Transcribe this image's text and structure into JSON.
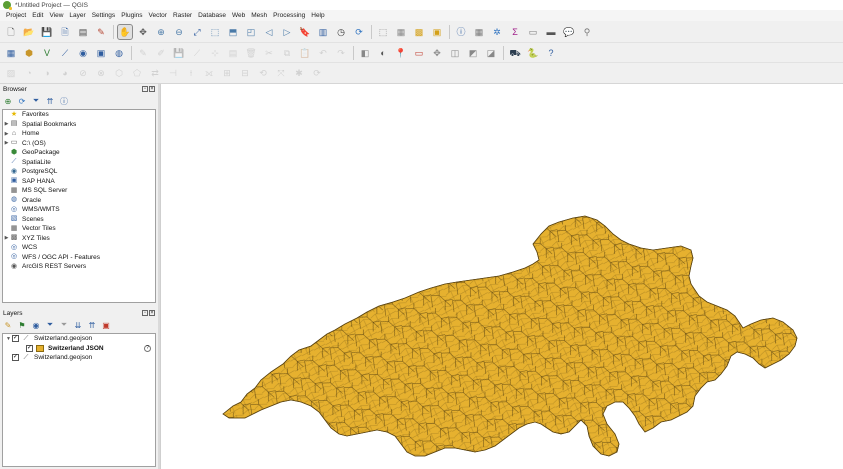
{
  "window": {
    "title": "*Untitled Project — QGIS"
  },
  "menu": [
    "Project",
    "Edit",
    "View",
    "Layer",
    "Settings",
    "Plugins",
    "Vector",
    "Raster",
    "Database",
    "Web",
    "Mesh",
    "Processing",
    "Help"
  ],
  "toolbars": {
    "row1": [
      {
        "name": "new-project-icon",
        "glyph": "🗋",
        "color": "#555",
        "active": false,
        "dim": false
      },
      {
        "name": "open-project-icon",
        "glyph": "📂",
        "color": "#c8962b",
        "active": false,
        "dim": false
      },
      {
        "name": "save-project-icon",
        "glyph": "💾",
        "color": "#2f5d9f",
        "active": false,
        "dim": false
      },
      {
        "name": "save-as-icon",
        "glyph": "🗎",
        "color": "#2f5d9f",
        "active": false,
        "dim": false
      },
      {
        "name": "print-layout-icon",
        "glyph": "▤",
        "color": "#444",
        "active": false,
        "dim": false
      },
      {
        "name": "style-manager-icon",
        "glyph": "✎",
        "color": "#b54632",
        "active": false,
        "dim": false
      },
      {
        "sep": true
      },
      {
        "name": "pan-map-icon",
        "glyph": "✋",
        "color": "#333",
        "active": true,
        "dim": false
      },
      {
        "name": "pan-to-selection-icon",
        "glyph": "✥",
        "color": "#555",
        "active": false,
        "dim": false
      },
      {
        "name": "zoom-in-icon",
        "glyph": "⊕",
        "color": "#4a7aa8",
        "active": false,
        "dim": false
      },
      {
        "name": "zoom-out-icon",
        "glyph": "⊖",
        "color": "#4a7aa8",
        "active": false,
        "dim": false
      },
      {
        "name": "zoom-full-icon",
        "glyph": "⤢",
        "color": "#2f5d9f",
        "active": false,
        "dim": false
      },
      {
        "name": "zoom-selection-icon",
        "glyph": "⬚",
        "color": "#4a7aa8",
        "active": false,
        "dim": false
      },
      {
        "name": "zoom-layer-icon",
        "glyph": "⬒",
        "color": "#4a7aa8",
        "active": false,
        "dim": false
      },
      {
        "name": "zoom-native-icon",
        "glyph": "◰",
        "color": "#4a7aa8",
        "active": false,
        "dim": false
      },
      {
        "name": "zoom-last-icon",
        "glyph": "◁",
        "color": "#4a7aa8",
        "active": false,
        "dim": false
      },
      {
        "name": "zoom-next-icon",
        "glyph": "▷",
        "color": "#4a7aa8",
        "active": false,
        "dim": false
      },
      {
        "name": "new-bookmark-icon",
        "glyph": "🔖",
        "color": "#2f5d9f",
        "active": false,
        "dim": false
      },
      {
        "name": "show-bookmarks-icon",
        "glyph": "▥",
        "color": "#2f5d9f",
        "active": false,
        "dim": false
      },
      {
        "name": "temporal-controller-icon",
        "glyph": "◷",
        "color": "#333",
        "active": false,
        "dim": false
      },
      {
        "name": "refresh-icon",
        "glyph": "⟳",
        "color": "#2f73c0",
        "active": false,
        "dim": false
      },
      {
        "sep": true
      },
      {
        "name": "select-features-icon",
        "glyph": "⬚",
        "color": "#888",
        "active": false,
        "dim": false
      },
      {
        "name": "select-by-value-icon",
        "glyph": "▦",
        "color": "#888",
        "active": false,
        "dim": false
      },
      {
        "name": "deselect-icon",
        "glyph": "▩",
        "color": "#d4a017",
        "active": false,
        "dim": false
      },
      {
        "name": "select-by-location-icon",
        "glyph": "▣",
        "color": "#d4a017",
        "active": false,
        "dim": false
      },
      {
        "sep": true
      },
      {
        "name": "identify-icon",
        "glyph": "ⓘ",
        "color": "#2f5d9f",
        "active": false,
        "dim": false
      },
      {
        "name": "attribute-table-icon",
        "glyph": "▦",
        "color": "#777",
        "active": false,
        "dim": false
      },
      {
        "name": "field-calculator-icon",
        "glyph": "✲",
        "color": "#2f73c0",
        "active": false,
        "dim": false
      },
      {
        "name": "statistics-icon",
        "glyph": "Σ",
        "color": "#a0208a",
        "active": false,
        "dim": false
      },
      {
        "name": "open-table-icon",
        "glyph": "▭",
        "color": "#777",
        "active": false,
        "dim": false
      },
      {
        "name": "measure-icon",
        "glyph": "▬",
        "color": "#555",
        "active": false,
        "dim": false
      },
      {
        "name": "map-tips-icon",
        "glyph": "💬",
        "color": "#e8c21a",
        "active": false,
        "dim": false
      },
      {
        "name": "search-icon",
        "glyph": "⚲",
        "color": "#777",
        "active": false,
        "dim": false
      }
    ],
    "row2": [
      {
        "name": "data-source-manager-icon",
        "glyph": "▦",
        "color": "#2f5d9f",
        "active": false,
        "dim": false
      },
      {
        "name": "new-geopackage-layer-icon",
        "glyph": "⬢",
        "color": "#c8962b",
        "active": false,
        "dim": false
      },
      {
        "name": "add-vector-layer-icon",
        "glyph": "V",
        "color": "#2e7d32",
        "active": false,
        "dim": false
      },
      {
        "name": "add-raster-layer-icon",
        "glyph": "⟋",
        "color": "#2f5d9f",
        "active": false,
        "dim": false
      },
      {
        "name": "add-postgis-layer-icon",
        "glyph": "◉",
        "color": "#2f5d9f",
        "active": false,
        "dim": false
      },
      {
        "name": "add-mssql-layer-icon",
        "glyph": "▣",
        "color": "#2f5d9f",
        "active": false,
        "dim": false
      },
      {
        "name": "add-wms-layer-icon",
        "glyph": "◍",
        "color": "#2f5d9f",
        "active": false,
        "dim": false
      },
      {
        "sep": true
      },
      {
        "name": "toggle-editing-icon",
        "glyph": "✎",
        "color": "#999",
        "active": false,
        "dim": true
      },
      {
        "name": "edit-pencil-icon",
        "glyph": "✐",
        "color": "#999",
        "active": false,
        "dim": true
      },
      {
        "name": "save-edits-icon",
        "glyph": "💾",
        "color": "#999",
        "active": false,
        "dim": true
      },
      {
        "name": "digitize-icon",
        "glyph": "⟋",
        "color": "#999",
        "active": false,
        "dim": true
      },
      {
        "name": "vertex-tool-icon",
        "glyph": "⊹",
        "color": "#999",
        "active": false,
        "dim": true
      },
      {
        "name": "modify-attributes-icon",
        "glyph": "▤",
        "color": "#999",
        "active": false,
        "dim": true
      },
      {
        "name": "delete-selected-icon",
        "glyph": "🗑",
        "color": "#999",
        "active": false,
        "dim": true
      },
      {
        "name": "cut-features-icon",
        "glyph": "✂",
        "color": "#999",
        "active": false,
        "dim": true
      },
      {
        "name": "copy-features-icon",
        "glyph": "⧉",
        "color": "#999",
        "active": false,
        "dim": true
      },
      {
        "name": "paste-features-icon",
        "glyph": "📋",
        "color": "#999",
        "active": false,
        "dim": true
      },
      {
        "name": "undo-icon",
        "glyph": "↶",
        "color": "#999",
        "active": false,
        "dim": true
      },
      {
        "name": "redo-icon",
        "glyph": "↷",
        "color": "#999",
        "active": false,
        "dim": true
      },
      {
        "sep": true
      },
      {
        "name": "label-tool-icon",
        "glyph": "◧",
        "color": "#888",
        "active": false,
        "dim": false
      },
      {
        "name": "layer-labeling-icon",
        "glyph": "◐",
        "color": "#555",
        "active": false,
        "dim": false
      },
      {
        "name": "pin-labels-icon",
        "glyph": "📍",
        "color": "#c0392b",
        "active": false,
        "dim": false
      },
      {
        "name": "highlight-labels-icon",
        "glyph": "▭",
        "color": "#c0392b",
        "active": false,
        "dim": false
      },
      {
        "name": "move-label-icon",
        "glyph": "✥",
        "color": "#888",
        "active": false,
        "dim": false
      },
      {
        "name": "rotate-label-icon",
        "glyph": "◫",
        "color": "#888",
        "active": false,
        "dim": false
      },
      {
        "name": "change-label-icon",
        "glyph": "◩",
        "color": "#888",
        "active": false,
        "dim": false
      },
      {
        "name": "show-hide-labels-icon",
        "glyph": "◪",
        "color": "#888",
        "active": false,
        "dim": false
      },
      {
        "sep": true
      },
      {
        "name": "gps-tracker-icon",
        "glyph": "⛟",
        "color": "#2c3e50",
        "active": false,
        "dim": false
      },
      {
        "name": "python-console-icon",
        "glyph": "🐍",
        "color": "#2f73c0",
        "active": false,
        "dim": false
      },
      {
        "name": "help-contents-icon",
        "glyph": "?",
        "color": "#2f5d9f",
        "active": false,
        "dim": false
      }
    ],
    "row3": [
      {
        "name": "digitize-shape-icon",
        "glyph": "▨",
        "color": "#999",
        "active": false,
        "dim": true
      },
      {
        "name": "add-ring-icon",
        "glyph": "◔",
        "color": "#999",
        "active": false,
        "dim": true
      },
      {
        "name": "add-part-icon",
        "glyph": "◑",
        "color": "#999",
        "active": false,
        "dim": true
      },
      {
        "name": "fill-ring-icon",
        "glyph": "◕",
        "color": "#999",
        "active": false,
        "dim": true
      },
      {
        "name": "delete-ring-icon",
        "glyph": "⊘",
        "color": "#999",
        "active": false,
        "dim": true
      },
      {
        "name": "delete-part-icon",
        "glyph": "⊗",
        "color": "#999",
        "active": false,
        "dim": true
      },
      {
        "name": "reshape-icon",
        "glyph": "⬡",
        "color": "#999",
        "active": false,
        "dim": true
      },
      {
        "name": "offset-curve-icon",
        "glyph": "⬠",
        "color": "#999",
        "active": false,
        "dim": true
      },
      {
        "name": "reverse-line-icon",
        "glyph": "⇄",
        "color": "#999",
        "active": false,
        "dim": true
      },
      {
        "name": "trim-extend-icon",
        "glyph": "⊣",
        "color": "#999",
        "active": false,
        "dim": true
      },
      {
        "name": "split-features-icon",
        "glyph": "⟊",
        "color": "#999",
        "active": false,
        "dim": true
      },
      {
        "name": "split-parts-icon",
        "glyph": "⟗",
        "color": "#999",
        "active": false,
        "dim": true
      },
      {
        "name": "merge-features-icon",
        "glyph": "⊞",
        "color": "#999",
        "active": false,
        "dim": true
      },
      {
        "name": "merge-attributes-icon",
        "glyph": "⊟",
        "color": "#999",
        "active": false,
        "dim": true
      },
      {
        "name": "rotate-point-symbols-icon",
        "glyph": "⟲",
        "color": "#999",
        "active": false,
        "dim": true
      },
      {
        "name": "offset-point-symbols-icon",
        "glyph": "⤧",
        "color": "#999",
        "active": false,
        "dim": true
      },
      {
        "name": "simplify-icon",
        "glyph": "✱",
        "color": "#999",
        "active": false,
        "dim": true
      },
      {
        "name": "rotate-feature-icon",
        "glyph": "⟳",
        "color": "#999",
        "active": false,
        "dim": true
      }
    ]
  },
  "browser": {
    "title": "Browser",
    "tools": [
      {
        "name": "add-selected-layers-icon",
        "glyph": "⊕",
        "color": "#2e7d32"
      },
      {
        "name": "refresh-browser-icon",
        "glyph": "⟳",
        "color": "#2f73c0"
      },
      {
        "name": "filter-browser-icon",
        "glyph": "⏷",
        "color": "#2f5d9f"
      },
      {
        "name": "collapse-all-icon",
        "glyph": "⇈",
        "color": "#2f5d9f"
      },
      {
        "name": "enable-properties-icon",
        "glyph": "ⓘ",
        "color": "#2f5d9f"
      }
    ],
    "items": [
      {
        "label": "Favorites",
        "arrow": "",
        "icon": "★",
        "color": "#e6b800",
        "name": "favorites-icon"
      },
      {
        "label": "Spatial Bookmarks",
        "arrow": "▶",
        "icon": "▤",
        "color": "#555",
        "name": "spatial-bookmarks-icon"
      },
      {
        "label": "Home",
        "arrow": "▶",
        "icon": "⌂",
        "color": "#555",
        "name": "home-folder-icon"
      },
      {
        "label": "C:\\ (OS)",
        "arrow": "▶",
        "icon": "▭",
        "color": "#555",
        "name": "drive-icon"
      },
      {
        "label": "GeoPackage",
        "arrow": "",
        "icon": "⬢",
        "color": "#3a8a3a",
        "name": "geopackage-icon"
      },
      {
        "label": "SpatiaLite",
        "arrow": "",
        "icon": "⟋",
        "color": "#2f5d9f",
        "name": "spatialite-icon"
      },
      {
        "label": "PostgreSQL",
        "arrow": "",
        "icon": "◉",
        "color": "#336791",
        "name": "postgresql-icon"
      },
      {
        "label": "SAP HANA",
        "arrow": "",
        "icon": "▣",
        "color": "#2f5d9f",
        "name": "sap-hana-icon"
      },
      {
        "label": "MS SQL Server",
        "arrow": "",
        "icon": "▦",
        "color": "#555",
        "name": "mssql-icon"
      },
      {
        "label": "Oracle",
        "arrow": "",
        "icon": "◍",
        "color": "#2f5d9f",
        "name": "oracle-icon"
      },
      {
        "label": "WMS/WMTS",
        "arrow": "",
        "icon": "◎",
        "color": "#2f5d9f",
        "name": "wms-icon"
      },
      {
        "label": "Scenes",
        "arrow": "",
        "icon": "▧",
        "color": "#2f5d9f",
        "name": "scenes-icon"
      },
      {
        "label": "Vector Tiles",
        "arrow": "",
        "icon": "▦",
        "color": "#555",
        "name": "vector-tiles-icon"
      },
      {
        "label": "XYZ Tiles",
        "arrow": "▶",
        "icon": "▩",
        "color": "#555",
        "name": "xyz-tiles-icon"
      },
      {
        "label": "WCS",
        "arrow": "",
        "icon": "◎",
        "color": "#2f5d9f",
        "name": "wcs-icon"
      },
      {
        "label": "WFS / OGC API - Features",
        "arrow": "",
        "icon": "◎",
        "color": "#2f5d9f",
        "name": "wfs-icon"
      },
      {
        "label": "ArcGIS REST Servers",
        "arrow": "",
        "icon": "◉",
        "color": "#555",
        "name": "arcgis-rest-icon"
      }
    ]
  },
  "layers": {
    "title": "Layers",
    "tools": [
      {
        "name": "style-panel-icon",
        "glyph": "✎",
        "color": "#c8962b"
      },
      {
        "name": "add-group-icon",
        "glyph": "⚑",
        "color": "#2e7d32"
      },
      {
        "name": "manage-themes-icon",
        "glyph": "◉",
        "color": "#2f5d9f"
      },
      {
        "name": "filter-legend-icon",
        "glyph": "⏷",
        "color": "#2f5d9f"
      },
      {
        "name": "filter-expression-icon",
        "glyph": "⏷",
        "color": "#999"
      },
      {
        "name": "expand-all-icon",
        "glyph": "⇊",
        "color": "#2f5d9f"
      },
      {
        "name": "collapse-layers-icon",
        "glyph": "⇈",
        "color": "#2f5d9f"
      },
      {
        "name": "remove-layer-icon",
        "glyph": "▣",
        "color": "#c0392b"
      }
    ],
    "items": [
      {
        "label": "Switzerland.geojson",
        "indent": 0,
        "arrow": "▼",
        "checked": true,
        "type": "layer",
        "bold": false,
        "help": false
      },
      {
        "label": "Switzerland JSON",
        "indent": 1,
        "arrow": "",
        "checked": true,
        "type": "swatch",
        "bold": true,
        "help": true
      },
      {
        "label": "Switzerland.geojson",
        "indent": 0,
        "arrow": "",
        "checked": true,
        "type": "layer",
        "bold": false,
        "help": false
      }
    ]
  },
  "map": {
    "fill": "#e6b12f",
    "stroke": "#5a4310",
    "background": "#ffffff"
  }
}
